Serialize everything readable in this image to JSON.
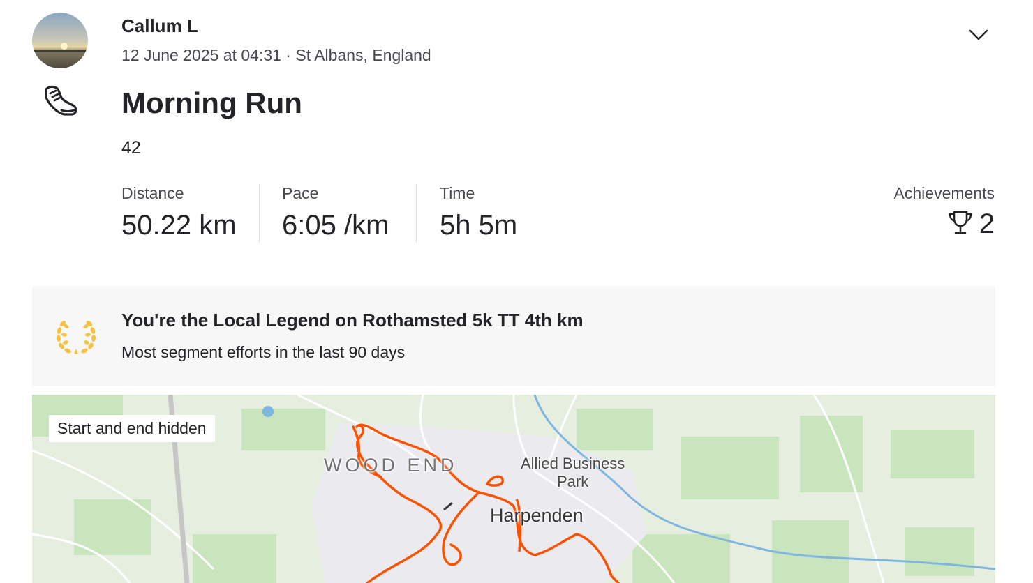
{
  "header": {
    "athlete_name": "Callum L",
    "meta": "12 June 2025 at 04:31 · St Albans, England",
    "collapse_icon": "chevron-down-icon"
  },
  "activity": {
    "sport_icon": "running-shoe-icon",
    "title": "Morning Run",
    "description": "42"
  },
  "stats": {
    "distance": {
      "label": "Distance",
      "value": "50.22 km"
    },
    "pace": {
      "label": "Pace",
      "value": "6:05 /km"
    },
    "time": {
      "label": "Time",
      "value": "5h 5m"
    },
    "achievements": {
      "label": "Achievements",
      "count": "2",
      "icon": "trophy-icon"
    }
  },
  "local_legend": {
    "icon": "laurel-icon",
    "title": "You're the Local Legend on Rothamsted 5k TT 4th km",
    "subtitle": "Most segment efforts in the last 90 days",
    "icon_color": "#F5C242"
  },
  "map": {
    "badge": "Start and end hidden",
    "labels": {
      "wood_end": "WOOD END",
      "allied_line1": "Allied Business",
      "allied_line2": "Park",
      "harpenden": "Harpenden"
    },
    "route_color": "#FC5200"
  }
}
